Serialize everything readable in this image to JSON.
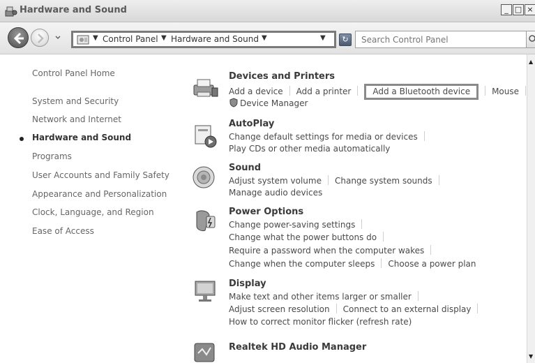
{
  "window": {
    "title": "Hardware and Sound"
  },
  "nav": {
    "breadcrumbs": [
      "Control Panel",
      "Hardware and Sound"
    ],
    "search_placeholder": "Search Control Panel"
  },
  "sidebar": {
    "items": [
      {
        "label": "Control Panel Home"
      },
      {
        "label": "System and Security"
      },
      {
        "label": "Network and Internet"
      },
      {
        "label": "Hardware and Sound",
        "active": true
      },
      {
        "label": "Programs"
      },
      {
        "label": "User Accounts and Family Safety"
      },
      {
        "label": "Appearance and Personalization"
      },
      {
        "label": "Clock, Language, and Region"
      },
      {
        "label": "Ease of Access"
      }
    ]
  },
  "categories": [
    {
      "title": "Devices and Printers",
      "icon": "printer-icon",
      "links": [
        "Add a device",
        "Add a printer",
        "Add a Bluetooth device",
        "Mouse",
        "Device Manager"
      ],
      "highlighted": "Add a Bluetooth device"
    },
    {
      "title": "AutoPlay",
      "icon": "autoplay-icon",
      "links": [
        "Change default settings for media or devices",
        "Play CDs or other media automatically"
      ]
    },
    {
      "title": "Sound",
      "icon": "speaker-icon",
      "links": [
        "Adjust system volume",
        "Change system sounds",
        "Manage audio devices"
      ]
    },
    {
      "title": "Power Options",
      "icon": "power-options-icon",
      "links": [
        "Change power-saving settings",
        "Change what the power buttons do",
        "Require a password when the computer wakes",
        "Change when the computer sleeps",
        "Choose a power plan"
      ]
    },
    {
      "title": "Display",
      "icon": "monitor-icon",
      "links": [
        "Make text and other items larger or smaller",
        "Adjust screen resolution",
        "Connect to an external display",
        "How to correct monitor flicker (refresh rate)"
      ]
    },
    {
      "title": "Realtek HD Audio Manager",
      "icon": "realtek-icon",
      "links": []
    }
  ]
}
